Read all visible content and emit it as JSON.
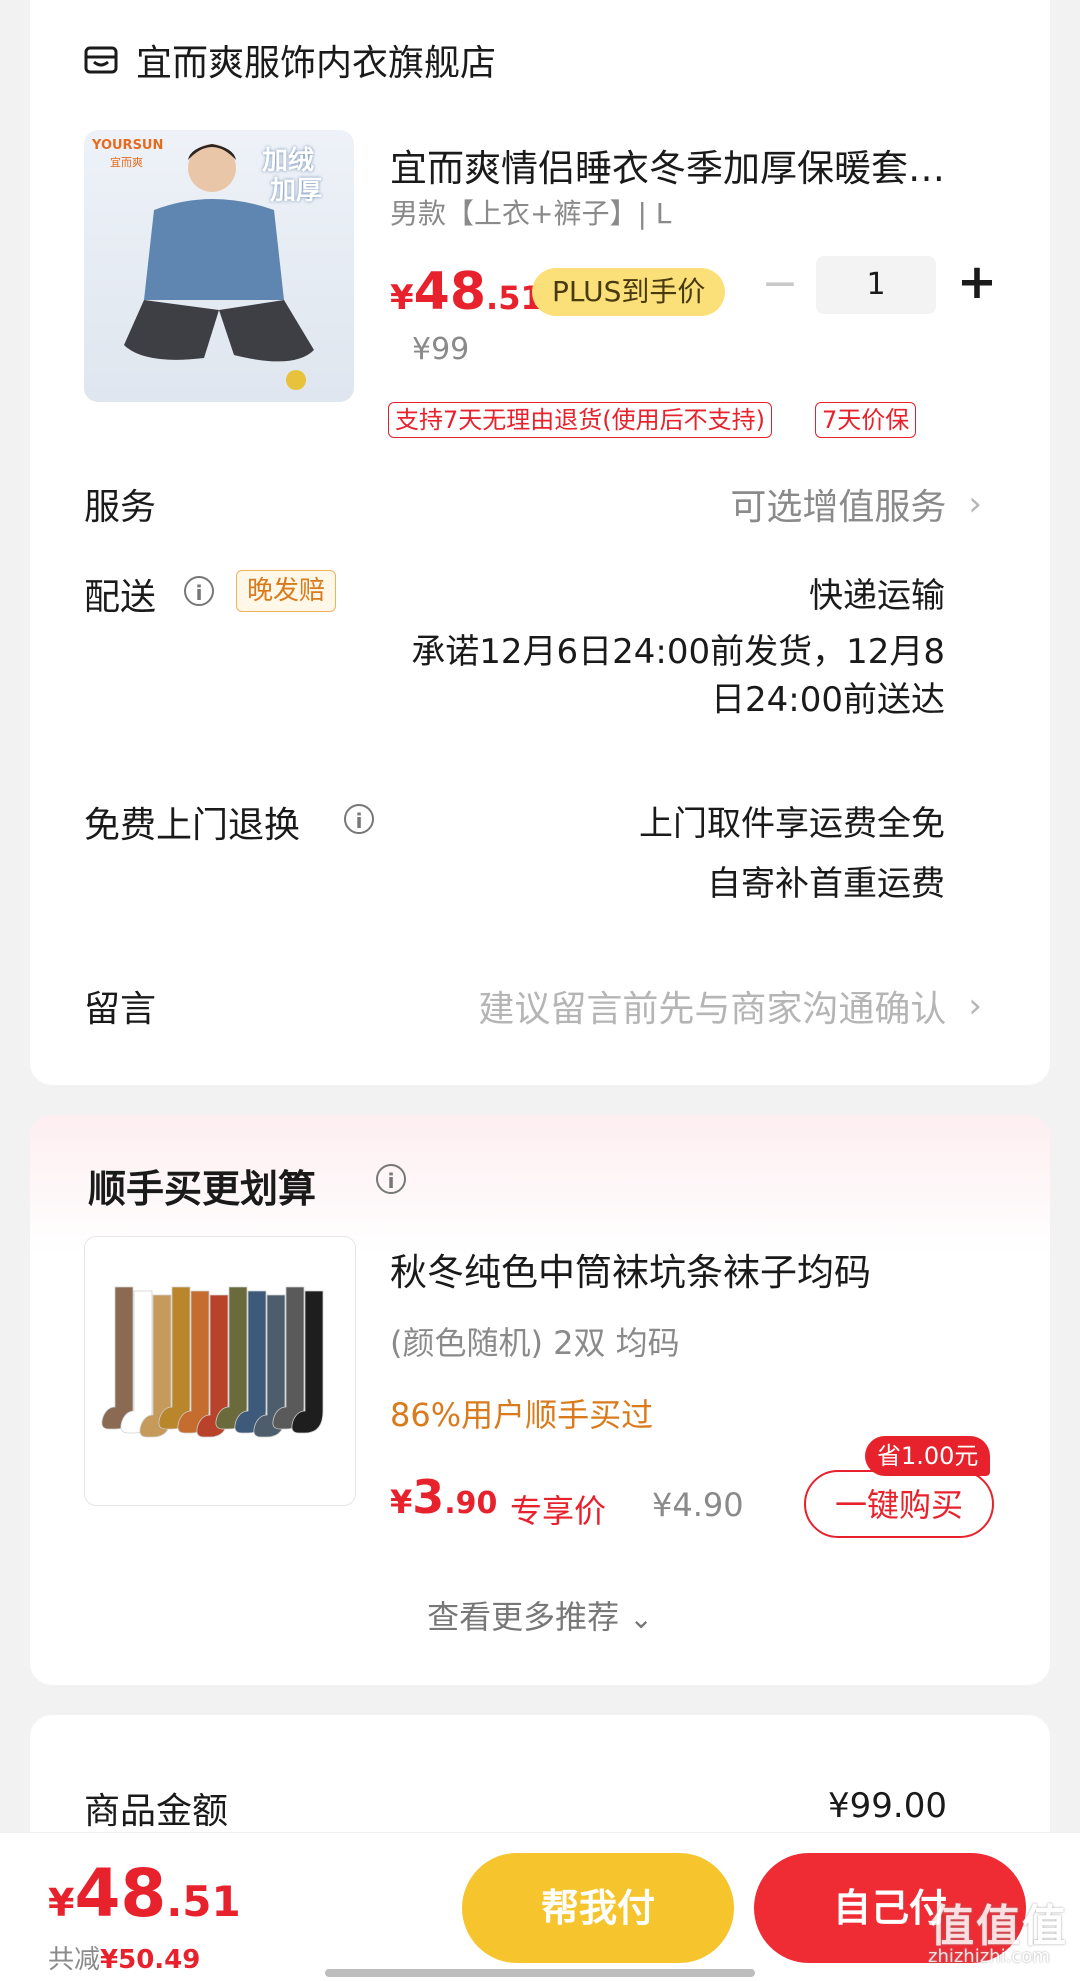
{
  "store": {
    "name": "宜而爽服饰内衣旗舰店"
  },
  "product": {
    "brand_logo": "YOURSUN",
    "brand_logo_cn": "宜而爽",
    "img_tag_1": "加绒",
    "img_tag_2": "加厚",
    "title": "宜而爽情侣睡衣冬季加厚保暖套…",
    "spec": "男款【上衣+裤子】| L",
    "price_symbol": "¥",
    "price_int": "48",
    "price_dec": ".51",
    "plus_label": "PLUS到手价",
    "original_price": "¥99",
    "quantity": "1",
    "minus_label": "−",
    "plus_qty_label": "+",
    "tags": [
      "支持7天无理由退货(使用后不支持)",
      "7天价保"
    ]
  },
  "service": {
    "label": "服务",
    "value": "可选增值服务"
  },
  "delivery": {
    "label": "配送",
    "badge": "晚发赔",
    "method": "快递运输",
    "promise_line1": "承诺12月6日24:00前发货，12月8",
    "promise_line2": "日24:00前送达"
  },
  "free_return": {
    "label": "免费上门退换",
    "line1": "上门取件享运费全免",
    "line2": "自寄补首重运费"
  },
  "message": {
    "label": "留言",
    "placeholder": "建议留言前先与商家沟通确认"
  },
  "addon": {
    "section_title": "顺手买更划算",
    "title": "秋冬纯色中筒袜坑条袜子均码",
    "spec": "(颜色随机) 2双    均码",
    "bought": "86%用户顺手买过",
    "price_symbol": "¥",
    "price_int": "3",
    "price_dec": ".90",
    "exclusive_label": "专享价",
    "original_price": "¥4.90",
    "save_badge": "省1.00元",
    "buy_label": "一键购买",
    "more_label": "查看更多推荐",
    "sock_colors": [
      "#8a6a52",
      "#ffffff",
      "#c69a5a",
      "#b9862c",
      "#c46d2e",
      "#b8432a",
      "#6b6a3c",
      "#3e5a7a",
      "#4e5d6b",
      "#5a5a5a",
      "#1e1e1e"
    ]
  },
  "summary": {
    "goods_amount_label": "商品金额",
    "goods_amount_value": "¥99.00"
  },
  "bottom_bar": {
    "price_symbol": "¥",
    "price_int": "48",
    "price_dec": ".51",
    "save_prefix": "共减",
    "save_amount": "¥50.49",
    "help_pay_label": "帮我付",
    "self_pay_label": "自己付"
  },
  "watermark": {
    "main": "值值值",
    "sub": "zhizhizhi.com"
  },
  "colors": {
    "accent_red": "#e8222c",
    "plus_gold": "#fbe07a",
    "orange": "#d97b1c",
    "help_yellow": "#f6c52e"
  }
}
